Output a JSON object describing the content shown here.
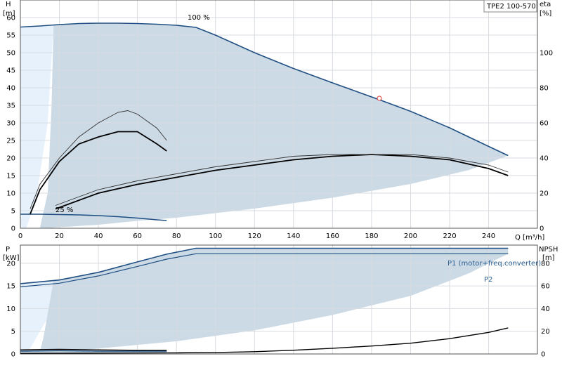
{
  "chart_data": [
    {
      "type": "line",
      "id": "head-chart",
      "title": "TPE2 100-570",
      "left_axis": {
        "label_line1": "H",
        "label_line2": "[m]",
        "ylim": [
          0,
          65
        ],
        "ticks": [
          0,
          5,
          10,
          15,
          20,
          25,
          30,
          35,
          40,
          45,
          50,
          55,
          60
        ]
      },
      "right_axis": {
        "label_line1": "eta",
        "label_line2": "[%]",
        "ylim": [
          0,
          130
        ],
        "ticks": [
          0,
          20,
          40,
          60,
          80,
          100
        ]
      },
      "x_axis": {
        "label": "Q [m³/h]",
        "xlim": [
          0,
          265
        ],
        "ticks": [
          0,
          20,
          40,
          60,
          80,
          100,
          120,
          140,
          160,
          180,
          200,
          220,
          240
        ]
      },
      "grid": true,
      "annotations": [
        {
          "text": "100 %",
          "x": 90,
          "y": 58.2
        },
        {
          "text": "25 %",
          "x": 18,
          "y": 4.6
        }
      ],
      "duty_point": {
        "x": 184,
        "y": 37
      },
      "series": [
        {
          "role": "head-max",
          "axis": "left",
          "x": [
            0,
            10,
            20,
            30,
            40,
            50,
            60,
            70,
            80,
            90,
            100,
            120,
            140,
            160,
            184,
            200,
            220,
            240,
            250
          ],
          "y": [
            57.3,
            57.6,
            58.0,
            58.3,
            58.4,
            58.4,
            58.3,
            58.1,
            57.8,
            57.2,
            55.0,
            50.0,
            45.5,
            41.4,
            36.6,
            33.3,
            28.6,
            23.3,
            20.7
          ]
        },
        {
          "role": "head-min",
          "axis": "left",
          "x": [
            0,
            10,
            20,
            30,
            40,
            50,
            60,
            70,
            75
          ],
          "y": [
            4.0,
            4.0,
            3.9,
            3.8,
            3.6,
            3.3,
            2.9,
            2.4,
            2.2
          ]
        },
        {
          "role": "eta-1",
          "axis": "right",
          "x": [
            5,
            10,
            20,
            30,
            40,
            50,
            60,
            70,
            75
          ],
          "y": [
            8,
            22,
            38,
            48,
            52,
            55,
            55,
            48,
            44
          ]
        },
        {
          "role": "eta-2",
          "axis": "right",
          "x": [
            5,
            10,
            20,
            30,
            40,
            50,
            55,
            60,
            70,
            75
          ],
          "y": [
            11,
            25,
            40,
            52,
            60,
            66,
            67,
            65,
            57,
            50
          ]
        },
        {
          "role": "eta-3",
          "axis": "right",
          "x": [
            18,
            40,
            60,
            80,
            100,
            120,
            140,
            160,
            180,
            200,
            220,
            240,
            250
          ],
          "y": [
            11,
            20,
            25,
            29,
            33,
            36,
            39,
            41,
            42,
            41,
            39,
            34,
            30
          ]
        },
        {
          "role": "eta-4",
          "axis": "right",
          "x": [
            18,
            40,
            60,
            80,
            100,
            120,
            140,
            160,
            180,
            200,
            220,
            240,
            250
          ],
          "y": [
            13,
            22,
            27,
            31,
            35,
            38,
            41,
            42,
            42,
            42,
            40,
            36,
            32
          ]
        }
      ]
    },
    {
      "type": "line",
      "id": "power-chart",
      "left_axis": {
        "label_line1": "P",
        "label_line2": "[kW]",
        "ylim": [
          0,
          24
        ],
        "ticks": [
          0,
          5,
          10,
          15,
          20
        ]
      },
      "right_axis": {
        "label_line1": "NPSH",
        "label_line2": "[m]",
        "ylim": [
          0,
          96
        ],
        "ticks": [
          0,
          20,
          40,
          60,
          80
        ]
      },
      "x_axis": {
        "xlim": [
          0,
          265
        ]
      },
      "grid": true,
      "annotations": [
        {
          "text": "P1 (motor+freq.converter)",
          "x": 180,
          "y": 23.5
        },
        {
          "text": "P2",
          "x": 250,
          "y": 20.9
        }
      ],
      "series": [
        {
          "role": "P1",
          "axis": "left",
          "x": [
            0,
            20,
            40,
            60,
            75,
            90,
            250
          ],
          "y": [
            15.5,
            16.3,
            18.0,
            20.3,
            22.0,
            23.3,
            23.3
          ]
        },
        {
          "role": "P2",
          "axis": "left",
          "x": [
            0,
            20,
            40,
            60,
            75,
            90,
            250
          ],
          "y": [
            14.8,
            15.6,
            17.2,
            19.3,
            20.9,
            22.1,
            22.1
          ]
        },
        {
          "role": "NPSH",
          "axis": "right",
          "x": [
            0,
            50,
            80,
            100,
            120,
            140,
            160,
            180,
            200,
            220,
            240,
            250
          ],
          "y": [
            0.5,
            0.8,
            1,
            1.3,
            2,
            3.3,
            5,
            7,
            9.5,
            13.5,
            19,
            23
          ]
        },
        {
          "role": "P1-min",
          "axis": "left",
          "x": [
            0,
            20,
            40,
            60,
            75
          ],
          "y": [
            0.9,
            1.0,
            0.9,
            0.8,
            0.8
          ]
        },
        {
          "role": "P2-min",
          "axis": "left",
          "x": [
            0,
            20,
            40,
            60,
            75
          ],
          "y": [
            0.6,
            0.7,
            0.6,
            0.6,
            0.6
          ]
        }
      ]
    }
  ]
}
